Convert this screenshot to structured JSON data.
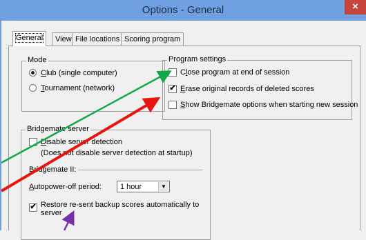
{
  "window": {
    "title": "Options - General",
    "close_glyph": "×"
  },
  "tabs": [
    {
      "label": "General",
      "active": true
    },
    {
      "label": "View",
      "active": false
    },
    {
      "label": "File locations",
      "active": false
    },
    {
      "label": "Scoring program",
      "active": false
    }
  ],
  "mode": {
    "title": "Mode",
    "options": [
      {
        "mnemonic": "C",
        "rest": "lub (single computer)",
        "selected": true
      },
      {
        "mnemonic": "T",
        "rest": "ournament (network)",
        "selected": false
      }
    ]
  },
  "program_settings": {
    "title": "Program settings",
    "items": [
      {
        "before": "C",
        "mnemonic": "l",
        "rest": "ose program at end of session",
        "checked": false
      },
      {
        "before": "",
        "mnemonic": "E",
        "rest": "rase original records of deleted scores",
        "checked": true
      },
      {
        "before": "",
        "mnemonic": "S",
        "rest": "how Bridgemate options when starting new session",
        "checked": false
      }
    ]
  },
  "bridgemate_server": {
    "title": "Bridgemate server",
    "disable_detection": {
      "mnemonic": "D",
      "rest": "isable server detection",
      "checked": false
    },
    "disable_detection_note": "(Does not disable server detection at startup)",
    "bridgemate2_label": "Bridgemate II:",
    "autopower_label_mnemonic": "A",
    "autopower_label_rest": "utopower-off period:",
    "autopower_value": "1 hour",
    "restore_line1": "Restore re-sent backup scores automatically to",
    "restore_line2": "server",
    "restore_checked": true
  },
  "colors": {
    "green_arrow": "#12a84a",
    "red_arrow": "#e8140e",
    "purple_arrow": "#7430a8",
    "titlebar": "#6fa0e2",
    "close": "#c7443c"
  },
  "check_glyph": "✔"
}
